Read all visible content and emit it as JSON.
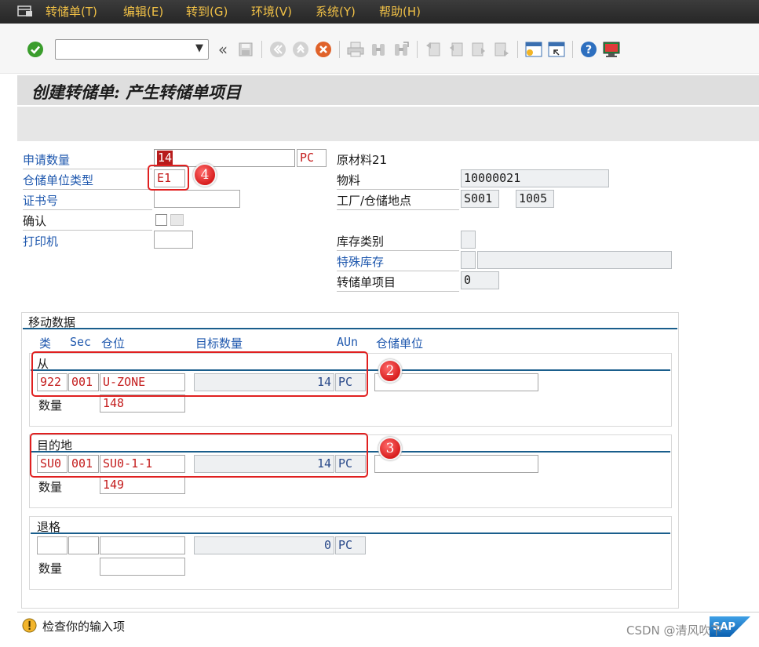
{
  "menu": {
    "items": [
      "转储单(T)",
      "编辑(E)",
      "转到(G)",
      "环境(V)",
      "系统(Y)",
      "帮助(H)"
    ]
  },
  "toolbar": {
    "command_value": "",
    "icons": [
      "enter-icon",
      "back-icon",
      "save-icon",
      "back-nav-icon",
      "exit-icon",
      "cancel-icon",
      "print-icon",
      "find-icon",
      "find-next-icon",
      "first-page-icon",
      "prev-page-icon",
      "next-page-icon",
      "last-page-icon",
      "new-session-icon",
      "shortcut-icon",
      "help-icon",
      "customize-layout-icon"
    ]
  },
  "title": "创建转储单: 产生转储单项目",
  "header_form": {
    "requested_qty_label": "申请数量",
    "requested_qty_value": "14",
    "requested_qty_unit": "PC",
    "storage_unit_type_label": "仓储单位类型",
    "storage_unit_type_value": "E1",
    "certificate_label": "证书号",
    "certificate_value": "",
    "confirm_label": "确认",
    "printer_label": "打印机",
    "printer_value": "",
    "material_desc": "原材料21",
    "material_label": "物料",
    "material_value": "10000021",
    "plant_label": "工厂/仓储地点",
    "plant_value": "S001",
    "storage_location_value": "1005",
    "stock_category_label": "库存类别",
    "stock_category_value": "",
    "special_stock_label": "特殊库存",
    "special_stock_value": "",
    "special_stock_number": "",
    "to_item_label": "转储单项目",
    "to_item_value": "0"
  },
  "movement": {
    "title": "移动数据",
    "columns": {
      "type": "类",
      "section": "Sec",
      "bin": "仓位",
      "target_qty": "目标数量",
      "aun": "AUn",
      "storage_unit": "仓储单位"
    },
    "quantity_label": "数量",
    "source": {
      "title": "从",
      "type": "922",
      "section": "001",
      "bin": "U-ZONE",
      "target_qty": "14",
      "aun": "PC",
      "storage_unit": "",
      "quant": "148"
    },
    "destination": {
      "title": "目的地",
      "type": "SU0",
      "section": "001",
      "bin": "SU0-1-1",
      "target_qty": "14",
      "aun": "PC",
      "storage_unit": "",
      "quant": "149"
    },
    "return": {
      "title": "退格",
      "type": "",
      "section": "",
      "bin": "",
      "target_qty": "0",
      "aun": "PC",
      "quant": ""
    }
  },
  "annotations": {
    "badge_2": "2",
    "badge_3": "3",
    "badge_4": "4"
  },
  "status": {
    "message": "检查你的输入项"
  },
  "brand": {
    "sap_logo_text": "SAP",
    "watermark": "CSDN @清风吹下"
  },
  "colors": {
    "menu_text": "#f0c046",
    "link_label": "#1f58ae",
    "required_value": "#c41d1d",
    "annotation_red": "#e02020",
    "group_line": "#1a5e8c"
  }
}
